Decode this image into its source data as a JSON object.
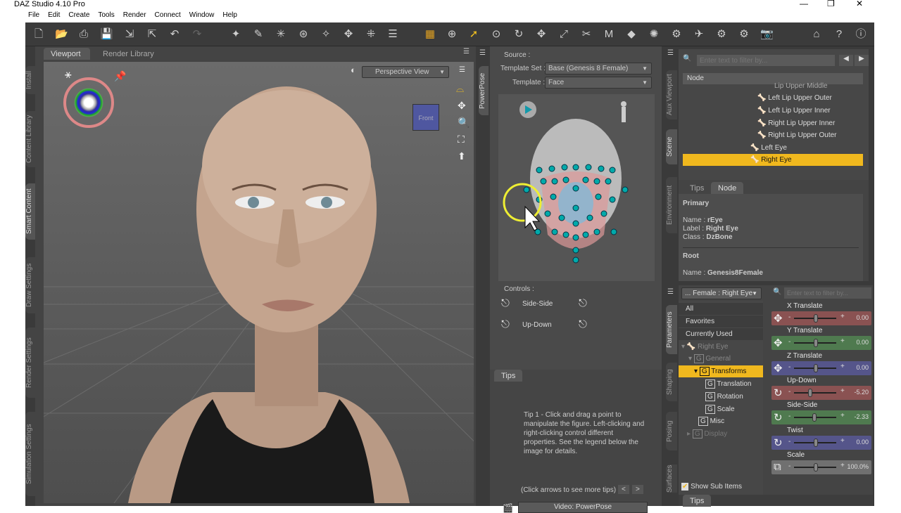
{
  "app": {
    "title": "DAZ Studio 4.10 Pro"
  },
  "menu": [
    "File",
    "Edit",
    "Create",
    "Tools",
    "Render",
    "Connect",
    "Window",
    "Help"
  ],
  "viewport_panel": {
    "tabs": [
      "Viewport",
      "Render Library"
    ],
    "camera": "Perspective View",
    "cube_label": "Front"
  },
  "left_tabs": [
    "Install",
    "Content Library",
    "Smart Content",
    "Draw Settings",
    "Render Settings",
    "Simulation Settings"
  ],
  "powerpose": {
    "tab": "PowerPose",
    "source_label": "Source :",
    "template_set_label": "Template Set :",
    "template_set": "Base (Genesis 8 Female)",
    "template_label": "Template :",
    "template": "Face",
    "controls_label": "Controls :",
    "controls": [
      "Side-Side",
      "Up-Down"
    ],
    "tips_tab": "Tips",
    "tip_text": "Tip 1 - Click and drag a point to manipulate the figure. Left-clicking and right-clicking control different properties. See the legend below the image for details.",
    "tip_nav": "(Click arrows to see more tips)",
    "video_button": "Video: PowerPose"
  },
  "scene": {
    "side_tabs": [
      "Aux Viewport",
      "Scene",
      "Environment"
    ],
    "filter_placeholder": "Enter text to filter by...",
    "column": "Node",
    "nodes": [
      "Lip Upper Middle",
      "Left Lip Upper Outer",
      "Left Lip Upper Inner",
      "Right Lip Upper Inner",
      "Right Lip Upper Outer",
      "Left Eye",
      "Right Eye"
    ],
    "selected": "Right Eye"
  },
  "node_info": {
    "tabs": [
      "Tips",
      "Node"
    ],
    "primary": "Primary",
    "name_label": "Name :",
    "name": "rEye",
    "label_label": "Label :",
    "label": "Right Eye",
    "class_label": "Class :",
    "class": "DzBone",
    "root": "Root",
    "root_name": "Genesis8Female"
  },
  "parameters": {
    "side_tabs": [
      "Parameters",
      "Shaping",
      "Posing",
      "Surfaces"
    ],
    "selector": "... Female : Right Eye",
    "filter_placeholder": "Enter text to filter by...",
    "categories": [
      "All",
      "Favorites",
      "Currently Used"
    ],
    "tree": [
      "Right Eye",
      "General",
      "Transforms",
      "Translation",
      "Rotation",
      "Scale",
      "Misc",
      "Display"
    ],
    "show_sub_items": "Show Sub Items",
    "tips_tab": "Tips",
    "items": [
      {
        "label": "X Translate",
        "value": "0.00",
        "pos": 0.5,
        "color": "#8a5252"
      },
      {
        "label": "Y Translate",
        "value": "0.00",
        "pos": 0.5,
        "color": "#4f7a4f"
      },
      {
        "label": "Z Translate",
        "value": "0.00",
        "pos": 0.5,
        "color": "#55558a"
      },
      {
        "label": "Up-Down",
        "value": "-5.20",
        "pos": 0.35,
        "color": "#8a5252"
      },
      {
        "label": "Side-Side",
        "value": "-2.33",
        "pos": 0.47,
        "color": "#4f7a4f"
      },
      {
        "label": "Twist",
        "value": "0.00",
        "pos": 0.5,
        "color": "#55558a"
      },
      {
        "label": "Scale",
        "value": "100.0%",
        "pos": 0.5,
        "color": "#707070"
      }
    ]
  }
}
